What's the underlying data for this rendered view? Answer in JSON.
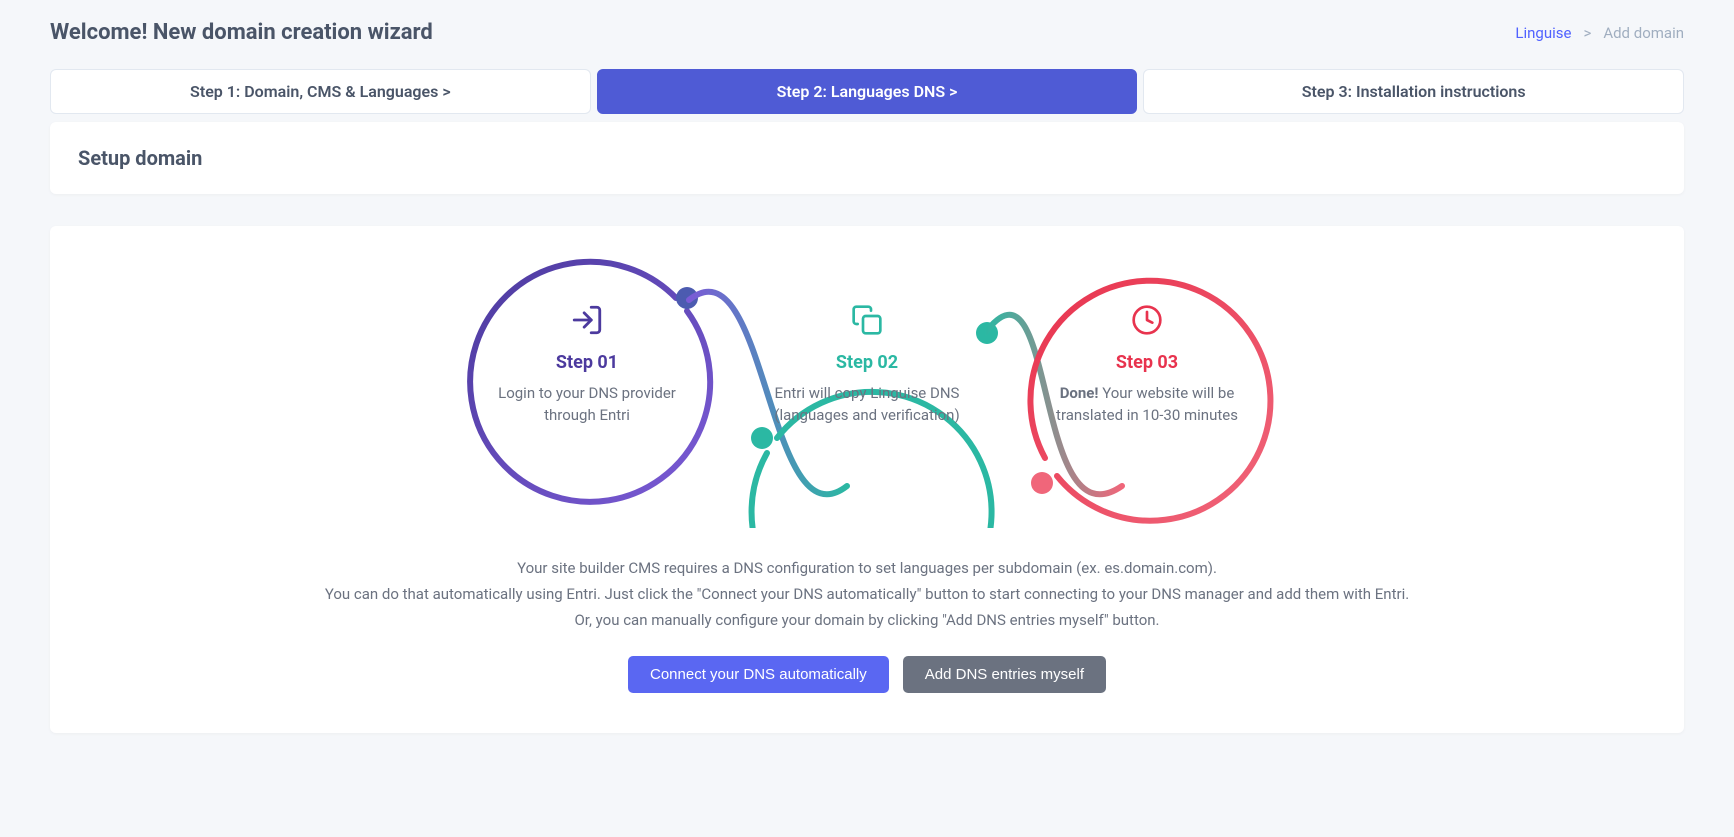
{
  "header": {
    "title": "Welcome! New domain creation wizard",
    "breadcrumb": {
      "root": "Linguise",
      "separator": ">",
      "current": "Add domain"
    }
  },
  "steps": {
    "tab1": "Step 1: Domain, CMS & Languages  >",
    "tab2": "Step 2: Languages DNS  >",
    "tab3": "Step 3: Installation instructions"
  },
  "setup": {
    "title": "Setup domain"
  },
  "diagram": {
    "step1": {
      "label": "Step 01",
      "desc": "Login to your DNS provider through Entri"
    },
    "step2": {
      "label": "Step 02",
      "desc": "Entri will copy Linguise DNS (languages and verification)"
    },
    "step3": {
      "label": "Step 03",
      "desc_bold": "Done!",
      "desc_rest": " Your website will be translated in 10-30 minutes"
    }
  },
  "info": {
    "line1": "Your site builder CMS requires a DNS configuration to set languages per subdomain (ex. es.domain.com).",
    "line2": "You can do that automatically using Entri. Just click the \"Connect your DNS automatically\" button to start connecting to your DNS manager and add them with Entri.",
    "line3": "Or, you can manually configure your domain by clicking \"Add DNS entries myself\" button."
  },
  "buttons": {
    "connect": "Connect your DNS automatically",
    "manual": "Add DNS entries myself"
  }
}
